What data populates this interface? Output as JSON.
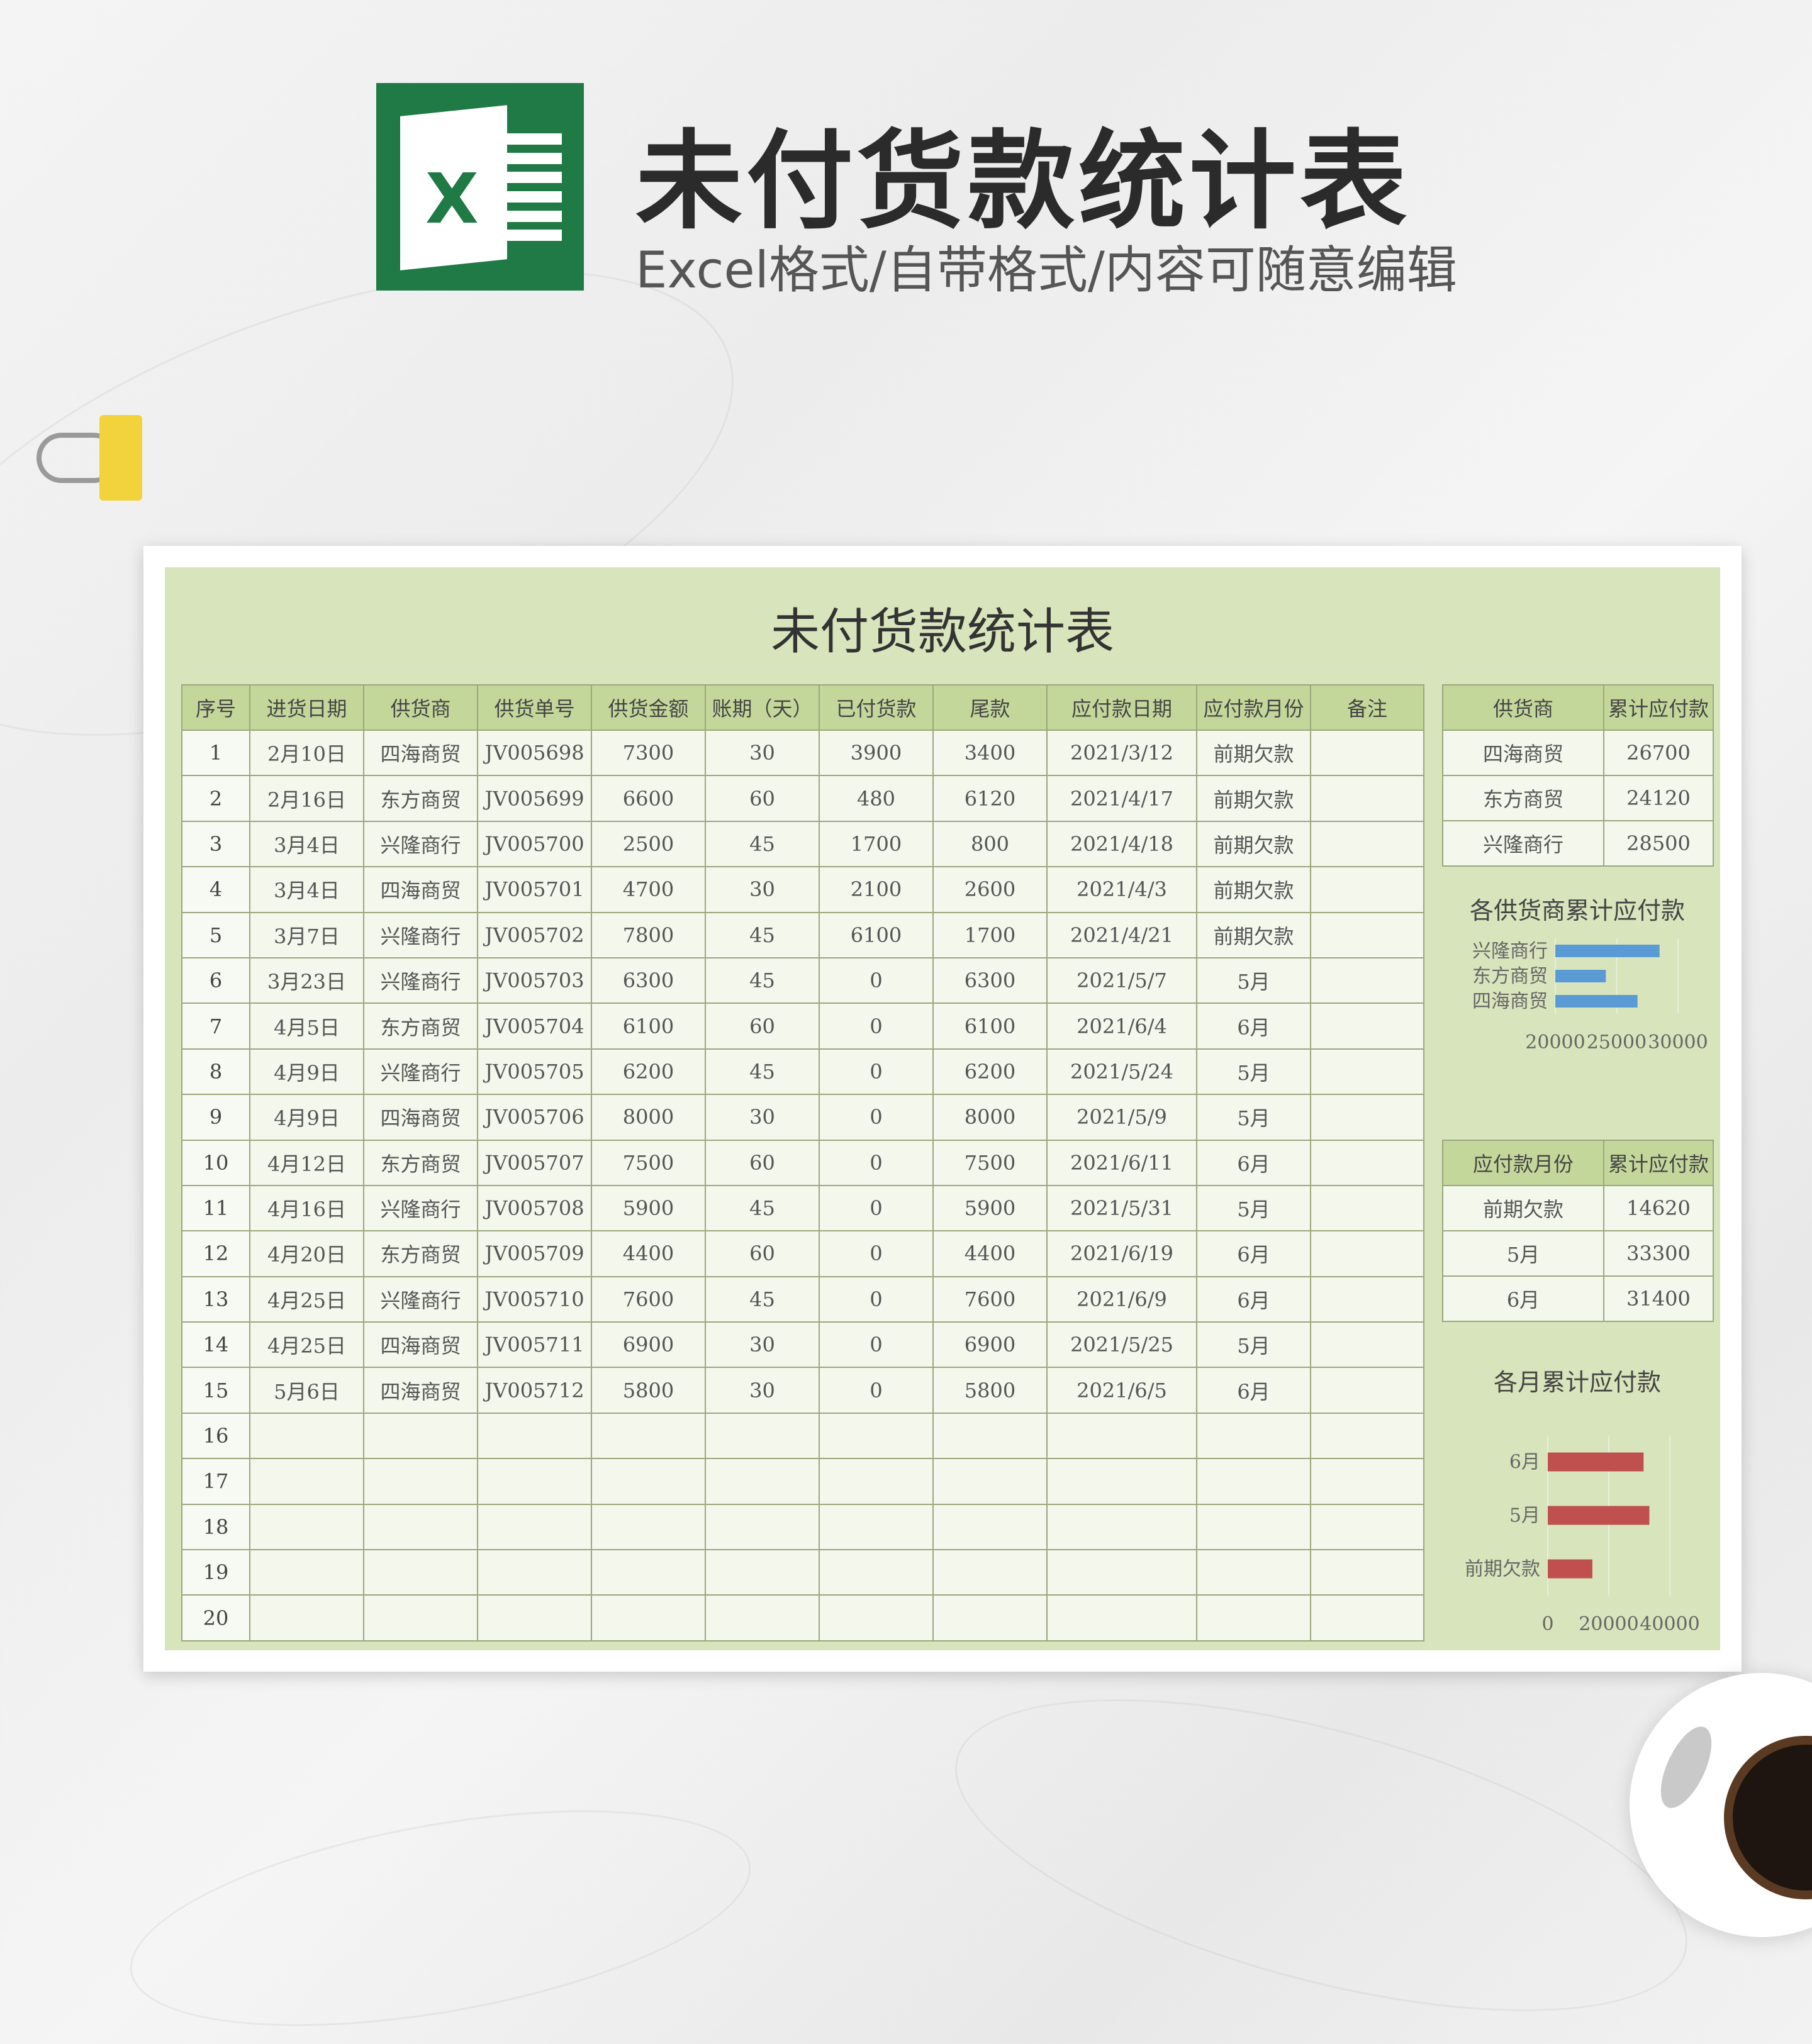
{
  "header": {
    "title": "未付货款统计表",
    "subtitle": "Excel格式/自带格式/内容可随意编辑",
    "logo_letter": "X"
  },
  "sheet": {
    "title": "未付货款统计表",
    "columns": [
      "序号",
      "进货日期",
      "供货商",
      "供货单号",
      "供货金额",
      "账期（天）",
      "已付货款",
      "尾款",
      "应付款日期",
      "应付款月份",
      "备注"
    ],
    "rows": [
      [
        "1",
        "2月10日",
        "四海商贸",
        "JV005698",
        "7300",
        "30",
        "3900",
        "3400",
        "2021/3/12",
        "前期欠款",
        ""
      ],
      [
        "2",
        "2月16日",
        "东方商贸",
        "JV005699",
        "6600",
        "60",
        "480",
        "6120",
        "2021/4/17",
        "前期欠款",
        ""
      ],
      [
        "3",
        "3月4日",
        "兴隆商行",
        "JV005700",
        "2500",
        "45",
        "1700",
        "800",
        "2021/4/18",
        "前期欠款",
        ""
      ],
      [
        "4",
        "3月4日",
        "四海商贸",
        "JV005701",
        "4700",
        "30",
        "2100",
        "2600",
        "2021/4/3",
        "前期欠款",
        ""
      ],
      [
        "5",
        "3月7日",
        "兴隆商行",
        "JV005702",
        "7800",
        "45",
        "6100",
        "1700",
        "2021/4/21",
        "前期欠款",
        ""
      ],
      [
        "6",
        "3月23日",
        "兴隆商行",
        "JV005703",
        "6300",
        "45",
        "0",
        "6300",
        "2021/5/7",
        "5月",
        ""
      ],
      [
        "7",
        "4月5日",
        "东方商贸",
        "JV005704",
        "6100",
        "60",
        "0",
        "6100",
        "2021/6/4",
        "6月",
        ""
      ],
      [
        "8",
        "4月9日",
        "兴隆商行",
        "JV005705",
        "6200",
        "45",
        "0",
        "6200",
        "2021/5/24",
        "5月",
        ""
      ],
      [
        "9",
        "4月9日",
        "四海商贸",
        "JV005706",
        "8000",
        "30",
        "0",
        "8000",
        "2021/5/9",
        "5月",
        ""
      ],
      [
        "10",
        "4月12日",
        "东方商贸",
        "JV005707",
        "7500",
        "60",
        "0",
        "7500",
        "2021/6/11",
        "6月",
        ""
      ],
      [
        "11",
        "4月16日",
        "兴隆商行",
        "JV005708",
        "5900",
        "45",
        "0",
        "5900",
        "2021/5/31",
        "5月",
        ""
      ],
      [
        "12",
        "4月20日",
        "东方商贸",
        "JV005709",
        "4400",
        "60",
        "0",
        "4400",
        "2021/6/19",
        "6月",
        ""
      ],
      [
        "13",
        "4月25日",
        "兴隆商行",
        "JV005710",
        "7600",
        "45",
        "0",
        "7600",
        "2021/6/9",
        "6月",
        ""
      ],
      [
        "14",
        "4月25日",
        "四海商贸",
        "JV005711",
        "6900",
        "30",
        "0",
        "6900",
        "2021/5/25",
        "5月",
        ""
      ],
      [
        "15",
        "5月6日",
        "四海商贸",
        "JV005712",
        "5800",
        "30",
        "0",
        "5800",
        "2021/6/5",
        "6月",
        ""
      ],
      [
        "16",
        "",
        "",
        "",
        "",
        "",
        "",
        "",
        "",
        "",
        ""
      ],
      [
        "17",
        "",
        "",
        "",
        "",
        "",
        "",
        "",
        "",
        "",
        ""
      ],
      [
        "18",
        "",
        "",
        "",
        "",
        "",
        "",
        "",
        "",
        "",
        ""
      ],
      [
        "19",
        "",
        "",
        "",
        "",
        "",
        "",
        "",
        "",
        "",
        ""
      ],
      [
        "20",
        "",
        "",
        "",
        "",
        "",
        "",
        "",
        "",
        "",
        ""
      ]
    ]
  },
  "supplier_summary": {
    "columns": [
      "供货商",
      "累计应付款"
    ],
    "rows": [
      [
        "四海商贸",
        "26700"
      ],
      [
        "东方商贸",
        "24120"
      ],
      [
        "兴隆商行",
        "28500"
      ]
    ]
  },
  "month_summary": {
    "columns": [
      "应付款月份",
      "累计应付款"
    ],
    "rows": [
      [
        "前期欠款",
        "14620"
      ],
      [
        "5月",
        "33300"
      ],
      [
        "6月",
        "31400"
      ]
    ]
  },
  "chart_data": [
    {
      "type": "bar",
      "orientation": "horizontal",
      "title": "各供货商累计应付款",
      "categories": [
        "兴隆商行",
        "东方商贸",
        "四海商贸"
      ],
      "values": [
        28500,
        24120,
        26700
      ],
      "xlim": [
        20000,
        30000
      ],
      "ticks": [
        "20000",
        "25000",
        "30000"
      ],
      "color": "#5b9bd5",
      "grid": true
    },
    {
      "type": "bar",
      "orientation": "horizontal",
      "title": "各月累计应付款",
      "categories": [
        "6月",
        "5月",
        "前期欠款"
      ],
      "values": [
        31400,
        33300,
        14620
      ],
      "xlim": [
        0,
        40000
      ],
      "ticks": [
        "0",
        "20000",
        "40000"
      ],
      "color": "#c0504d",
      "grid": true
    }
  ]
}
